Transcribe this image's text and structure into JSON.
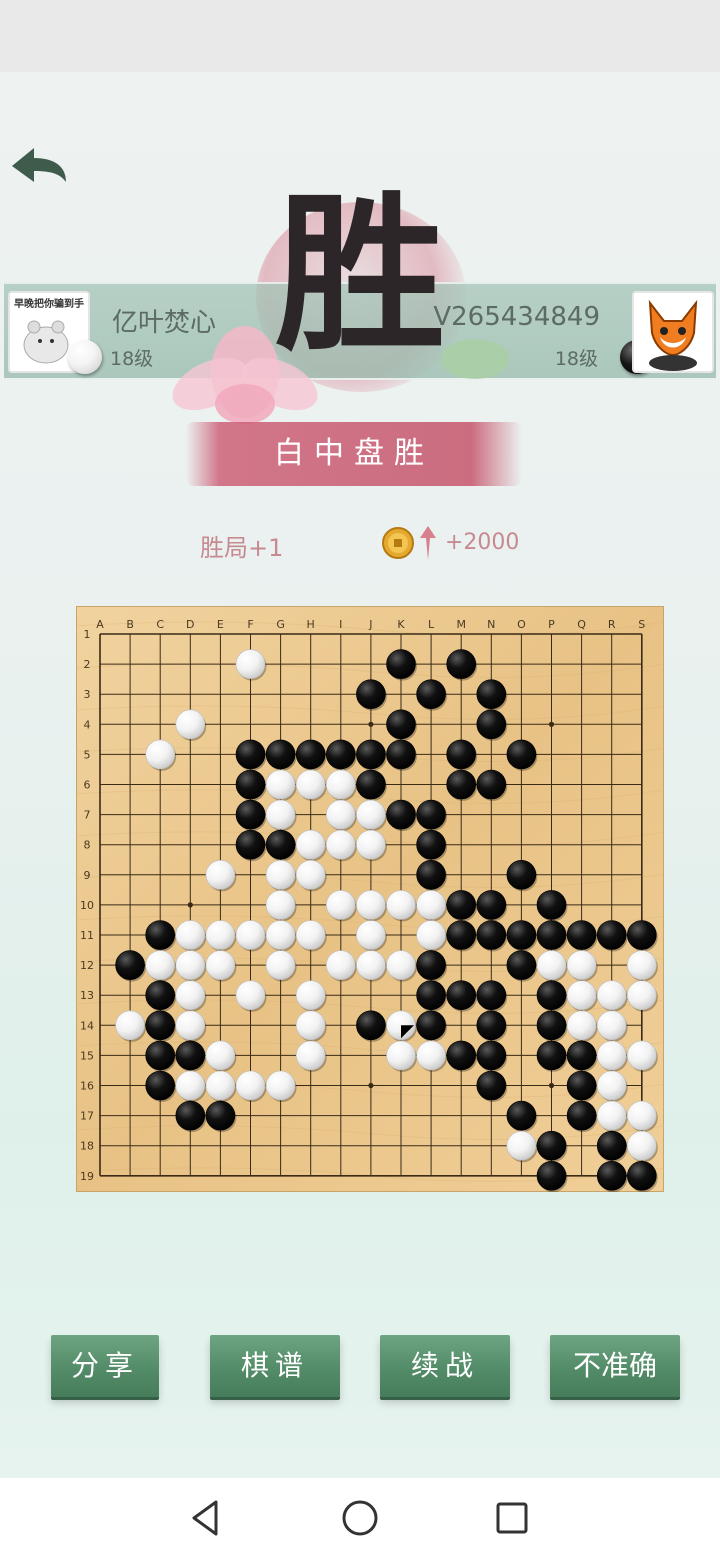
{
  "result": {
    "big_char": "胜",
    "result_text": "白中盘胜",
    "win_count": "胜局+1",
    "coin_gain": "+2000"
  },
  "players": {
    "left": {
      "name": "亿叶焚心",
      "level": "18级",
      "avatar_caption": "早晚把你骗到手",
      "stone": "white"
    },
    "right": {
      "name": "V265434849",
      "level": "18级",
      "stone": "black"
    }
  },
  "buttons": {
    "share": "分享",
    "record": "棋谱",
    "continue": "续战",
    "inaccurate": "不准确"
  },
  "icons": {
    "back": "back-arrow-icon",
    "coin": "coin-icon",
    "nav_back": "nav-back-icon",
    "nav_home": "nav-home-icon",
    "nav_recent": "nav-recent-icon"
  },
  "board": {
    "size": 19,
    "columns": [
      "A",
      "B",
      "C",
      "D",
      "E",
      "F",
      "G",
      "H",
      "I",
      "J",
      "K",
      "L",
      "M",
      "N",
      "O",
      "P",
      "Q",
      "R",
      "S"
    ],
    "rows": [
      "1",
      "2",
      "3",
      "4",
      "5",
      "6",
      "7",
      "8",
      "9",
      "10",
      "11",
      "12",
      "13",
      "14",
      "15",
      "16",
      "17",
      "18",
      "19"
    ],
    "last_move": "K14",
    "black": [
      "K2",
      "M2",
      "J3",
      "L3",
      "N3",
      "K4",
      "N4",
      "F5",
      "G5",
      "H5",
      "I5",
      "J5",
      "K5",
      "M5",
      "O5",
      "F6",
      "J6",
      "M6",
      "N6",
      "F7",
      "K7",
      "L7",
      "F8",
      "G8",
      "L8",
      "L9",
      "O9",
      "M10",
      "N10",
      "P10",
      "C11",
      "M11",
      "N11",
      "O11",
      "P11",
      "Q11",
      "R11",
      "S11",
      "B12",
      "L12",
      "O12",
      "C13",
      "L13",
      "M13",
      "N13",
      "P13",
      "C14",
      "J14",
      "L14",
      "N14",
      "P14",
      "C15",
      "D15",
      "M15",
      "N15",
      "P15",
      "Q15",
      "C16",
      "N16",
      "Q16",
      "D17",
      "E17",
      "O17",
      "Q17",
      "P18",
      "R18",
      "P19",
      "R19",
      "S19"
    ],
    "white": [
      "F2",
      "D4",
      "C5",
      "G6",
      "H6",
      "I6",
      "G7",
      "I7",
      "J7",
      "H8",
      "I8",
      "J8",
      "E9",
      "G9",
      "H9",
      "G10",
      "I10",
      "J10",
      "K10",
      "L10",
      "D11",
      "E11",
      "F11",
      "G11",
      "H11",
      "J11",
      "L11",
      "C12",
      "D12",
      "E12",
      "G12",
      "I12",
      "J12",
      "K12",
      "P12",
      "Q12",
      "S12",
      "D13",
      "F13",
      "H13",
      "Q13",
      "R13",
      "S13",
      "B14",
      "D14",
      "H14",
      "K14",
      "Q14",
      "R14",
      "E15",
      "H15",
      "K15",
      "L15",
      "R15",
      "S15",
      "D16",
      "E16",
      "F16",
      "G16",
      "R16",
      "R17",
      "S17",
      "O18",
      "S18"
    ]
  }
}
